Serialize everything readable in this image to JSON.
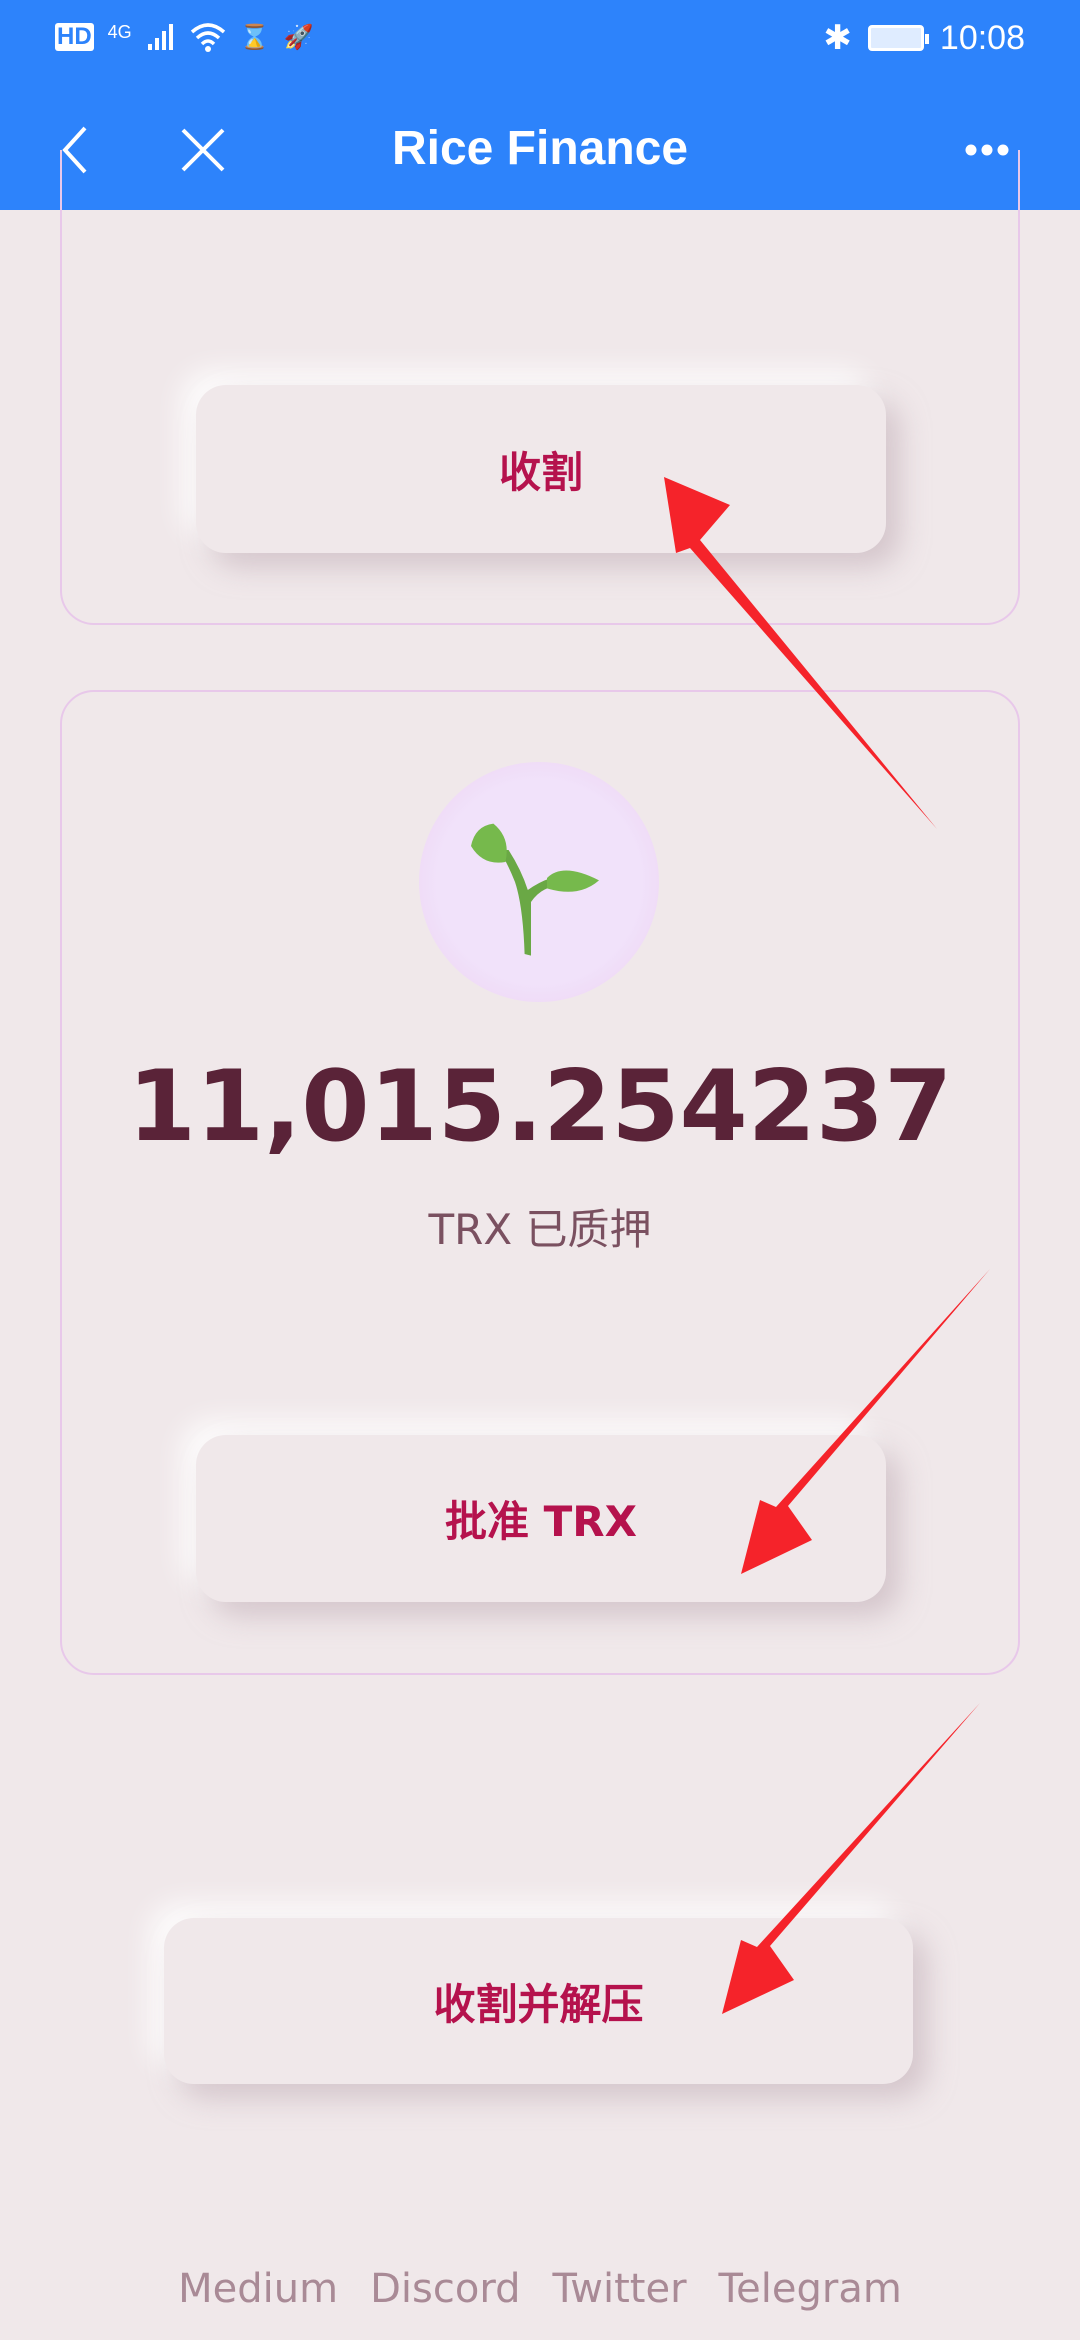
{
  "status_bar": {
    "left_indicators": [
      "HD",
      "4G"
    ],
    "time": "10:08"
  },
  "header": {
    "title": "Rice Finance",
    "back_icon": "chevron-left-icon",
    "close_icon": "close-icon",
    "more_icon": "more-dots-icon",
    "color": "#2d83fb"
  },
  "harvest_card": {
    "button_label": "收割"
  },
  "stake_card": {
    "icon": "sprout-icon",
    "amount": "11,015.254237",
    "amount_label": "TRX 已质押",
    "button_label": "批准 TRX"
  },
  "harvest_unstake_button": "收割并解压",
  "footer": {
    "links": [
      "Medium",
      "Discord",
      "Twitter",
      "Telegram"
    ]
  },
  "annotations": {
    "arrow_color": "#f5232a",
    "arrow_count": 3
  },
  "accent_color": "#b5124d"
}
